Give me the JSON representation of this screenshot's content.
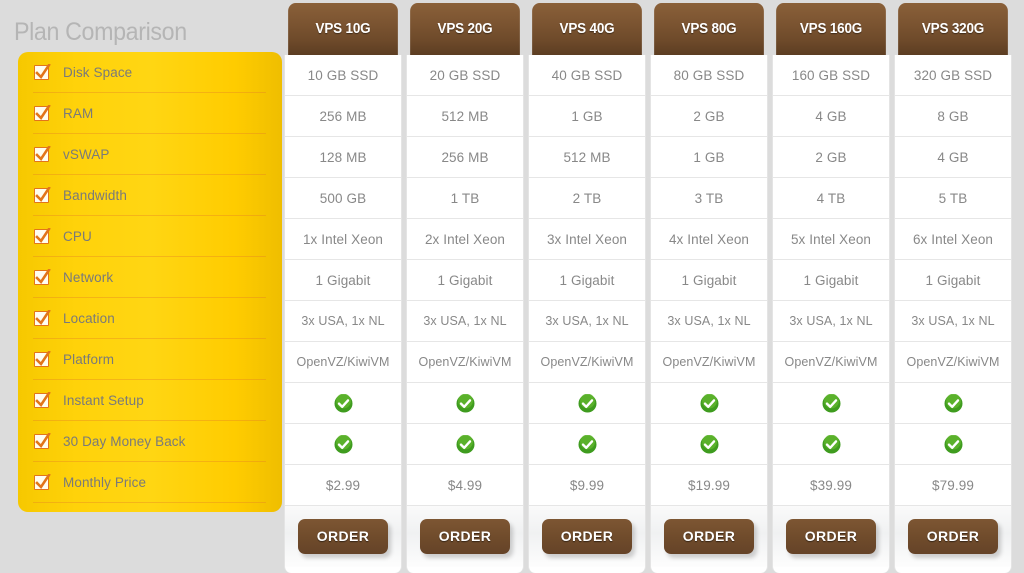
{
  "page": {
    "title": "Plan Comparison",
    "background_color": "#dcdcdc"
  },
  "colors": {
    "sidebar_yellow": "#ffd20a",
    "header_brown": "#6e4a2a",
    "button_brown": "#6f4b2b",
    "check_green": "#3f9c1f",
    "cell_text": "#888888",
    "title_gray": "#b5b5b5"
  },
  "sidebar": {
    "heading": "Plan Comparison",
    "items": [
      {
        "label": "Disk Space",
        "icon": "checkbox-checked-icon"
      },
      {
        "label": "RAM",
        "icon": "checkbox-checked-icon"
      },
      {
        "label": "vSWAP",
        "icon": "checkbox-checked-icon"
      },
      {
        "label": "Bandwidth",
        "icon": "checkbox-checked-icon"
      },
      {
        "label": "CPU",
        "icon": "checkbox-checked-icon"
      },
      {
        "label": "Network",
        "icon": "checkbox-checked-icon"
      },
      {
        "label": "Location",
        "icon": "checkbox-checked-icon"
      },
      {
        "label": "Platform",
        "icon": "checkbox-checked-icon"
      },
      {
        "label": "Instant Setup",
        "icon": "checkbox-checked-icon"
      },
      {
        "label": "30 Day Money Back",
        "icon": "checkbox-checked-icon"
      },
      {
        "label": "Monthly Price",
        "icon": "checkbox-checked-icon"
      }
    ]
  },
  "table": {
    "feature_rows": [
      "Disk Space",
      "RAM",
      "vSWAP",
      "Bandwidth",
      "CPU",
      "Network",
      "Location",
      "Platform",
      "Instant Setup",
      "30 Day Money Back",
      "Monthly Price"
    ],
    "order_label": "ORDER",
    "check_icon": "green-check-circle-icon",
    "plans": [
      {
        "name": "VPS 10G",
        "disk_space": "10 GB SSD",
        "ram": "256 MB",
        "vswap": "128 MB",
        "bandwidth": "500 GB",
        "cpu": "1x Intel Xeon",
        "network": "1 Gigabit",
        "location": "3x USA, 1x NL",
        "platform": "OpenVZ/KiwiVM",
        "instant_setup": true,
        "money_back": true,
        "price": "$2.99",
        "order": "ORDER"
      },
      {
        "name": "VPS 20G",
        "disk_space": "20 GB SSD",
        "ram": "512 MB",
        "vswap": "256 MB",
        "bandwidth": "1 TB",
        "cpu": "2x Intel Xeon",
        "network": "1 Gigabit",
        "location": "3x USA, 1x NL",
        "platform": "OpenVZ/KiwiVM",
        "instant_setup": true,
        "money_back": true,
        "price": "$4.99",
        "order": "ORDER"
      },
      {
        "name": "VPS 40G",
        "disk_space": "40 GB SSD",
        "ram": "1 GB",
        "vswap": "512 MB",
        "bandwidth": "2 TB",
        "cpu": "3x Intel Xeon",
        "network": "1 Gigabit",
        "location": "3x USA, 1x NL",
        "platform": "OpenVZ/KiwiVM",
        "instant_setup": true,
        "money_back": true,
        "price": "$9.99",
        "order": "ORDER"
      },
      {
        "name": "VPS 80G",
        "disk_space": "80 GB SSD",
        "ram": "2 GB",
        "vswap": "1 GB",
        "bandwidth": "3 TB",
        "cpu": "4x Intel Xeon",
        "network": "1 Gigabit",
        "location": "3x USA, 1x NL",
        "platform": "OpenVZ/KiwiVM",
        "instant_setup": true,
        "money_back": true,
        "price": "$19.99",
        "order": "ORDER"
      },
      {
        "name": "VPS 160G",
        "disk_space": "160 GB SSD",
        "ram": "4 GB",
        "vswap": "2 GB",
        "bandwidth": "4 TB",
        "cpu": "5x Intel Xeon",
        "network": "1 Gigabit",
        "location": "3x USA, 1x NL",
        "platform": "OpenVZ/KiwiVM",
        "instant_setup": true,
        "money_back": true,
        "price": "$39.99",
        "order": "ORDER"
      },
      {
        "name": "VPS 320G",
        "disk_space": "320 GB SSD",
        "ram": "8 GB",
        "vswap": "4 GB",
        "bandwidth": "5 TB",
        "cpu": "6x Intel Xeon",
        "network": "1 Gigabit",
        "location": "3x USA, 1x NL",
        "platform": "OpenVZ/KiwiVM",
        "instant_setup": true,
        "money_back": true,
        "price": "$79.99",
        "order": "ORDER"
      }
    ]
  }
}
